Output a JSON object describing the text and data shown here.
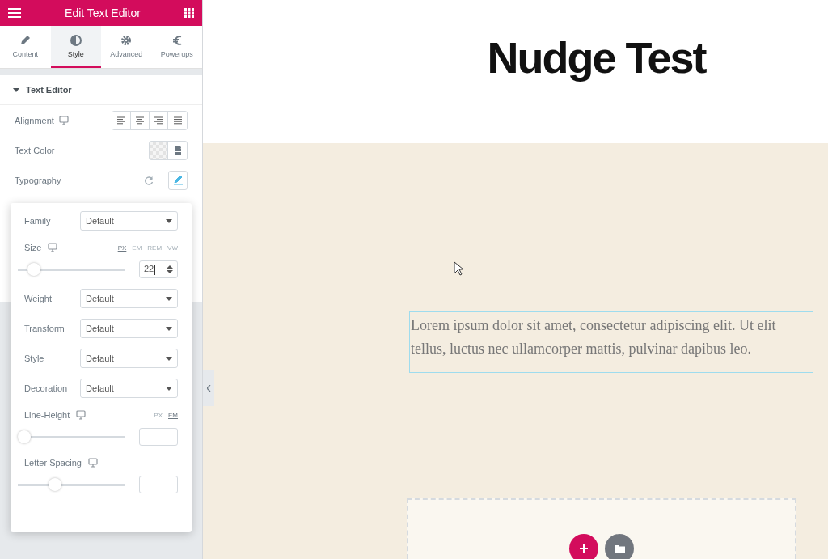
{
  "panel": {
    "title": "Edit Text Editor",
    "tabs": [
      {
        "label": "Content",
        "selected": false
      },
      {
        "label": "Style",
        "selected": true
      },
      {
        "label": "Advanced",
        "selected": false
      },
      {
        "label": "Powerups",
        "selected": false
      }
    ],
    "section": {
      "title": "Text Editor",
      "expanded": true
    },
    "alignment": {
      "label": "Alignment",
      "options": [
        {
          "selected": false
        },
        {
          "selected": false
        },
        {
          "selected": false
        },
        {
          "selected": false
        }
      ]
    },
    "text_color": {
      "label": "Text Color"
    },
    "typography": {
      "label": "Typography"
    },
    "popover": [
      {
        "kind": "select",
        "label": "Family",
        "value": "Default"
      },
      {
        "kind": "slider",
        "label": "Size",
        "units": [
          {
            "label": "PX",
            "selected": true
          },
          {
            "label": "EM",
            "selected": false
          },
          {
            "label": "REM",
            "selected": false
          },
          {
            "label": "VW",
            "selected": false
          }
        ],
        "level": 0.1,
        "value": "22"
      },
      {
        "kind": "select",
        "label": "Weight",
        "value": "Default"
      },
      {
        "kind": "select",
        "label": "Transform",
        "value": "Default"
      },
      {
        "kind": "select",
        "label": "Style",
        "value": "Default"
      },
      {
        "kind": "select",
        "label": "Decoration",
        "value": "Default"
      },
      {
        "kind": "slider",
        "label": "Line-Height",
        "units": [
          {
            "label": "PX",
            "selected": false
          },
          {
            "label": "EM",
            "selected": true
          }
        ],
        "level": 0
      },
      {
        "kind": "slider",
        "label": "Letter Spacing",
        "level": 0.33
      }
    ]
  },
  "canvas": {
    "heading": "Nudge Test",
    "paragraph": "Lorem ipsum dolor sit amet, consectetur adipiscing elit. Ut elit tellus, luctus nec ullamcorper mattis, pulvinar dapibus leo."
  }
}
